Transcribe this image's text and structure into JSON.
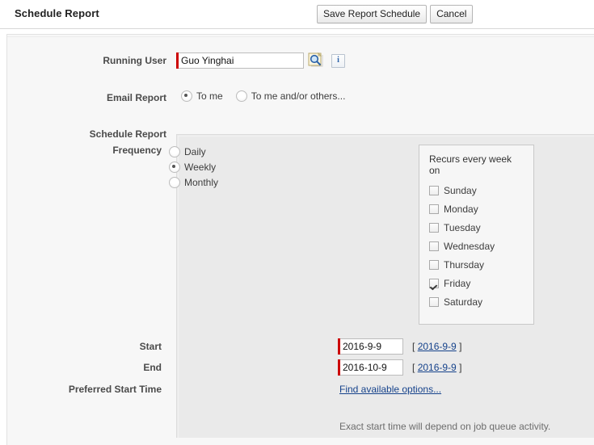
{
  "header": {
    "title": "Schedule Report",
    "save_label": "Save Report Schedule",
    "cancel_label": "Cancel"
  },
  "form": {
    "running_user": {
      "label": "Running User",
      "value": "Guo Yinghai",
      "placeholder": "",
      "lookup_icon": "magnifier-icon",
      "info_icon": "info-icon",
      "info_glyph": "i",
      "required_color": "#cc0000"
    },
    "email_report": {
      "label": "Email Report",
      "options": [
        {
          "label": "To me",
          "selected": true
        },
        {
          "label": "To me and/or others...",
          "selected": false
        }
      ]
    },
    "schedule_report": {
      "label": "Schedule Report",
      "frequency": {
        "label": "Frequency",
        "options": [
          {
            "label": "Daily",
            "selected": false
          },
          {
            "label": "Weekly",
            "selected": true
          },
          {
            "label": "Monthly",
            "selected": false
          }
        ]
      },
      "recurrence": {
        "title": "Recurs every week on",
        "days": [
          {
            "label": "Sunday",
            "checked": false
          },
          {
            "label": "Monday",
            "checked": false
          },
          {
            "label": "Tuesday",
            "checked": false
          },
          {
            "label": "Wednesday",
            "checked": false
          },
          {
            "label": "Thursday",
            "checked": false
          },
          {
            "label": "Friday",
            "checked": true
          },
          {
            "label": "Saturday",
            "checked": false
          }
        ]
      },
      "start": {
        "label": "Start",
        "value": "2016-9-9",
        "hint_open": "[",
        "hint_link": "2016-9-9",
        "hint_close": "]"
      },
      "end": {
        "label": "End",
        "value": "2016-10-9",
        "hint_open": "[",
        "hint_link": "2016-9-9",
        "hint_close": "]"
      },
      "preferred_start_time": {
        "label": "Preferred Start Time",
        "link_label": "Find available options..."
      },
      "footnote": "Exact start time will depend on job queue activity."
    }
  },
  "colors": {
    "link": "#15428b",
    "required": "#cc0000",
    "panel_bg": "#eaeaea",
    "page_bg": "#f7f7f7"
  }
}
